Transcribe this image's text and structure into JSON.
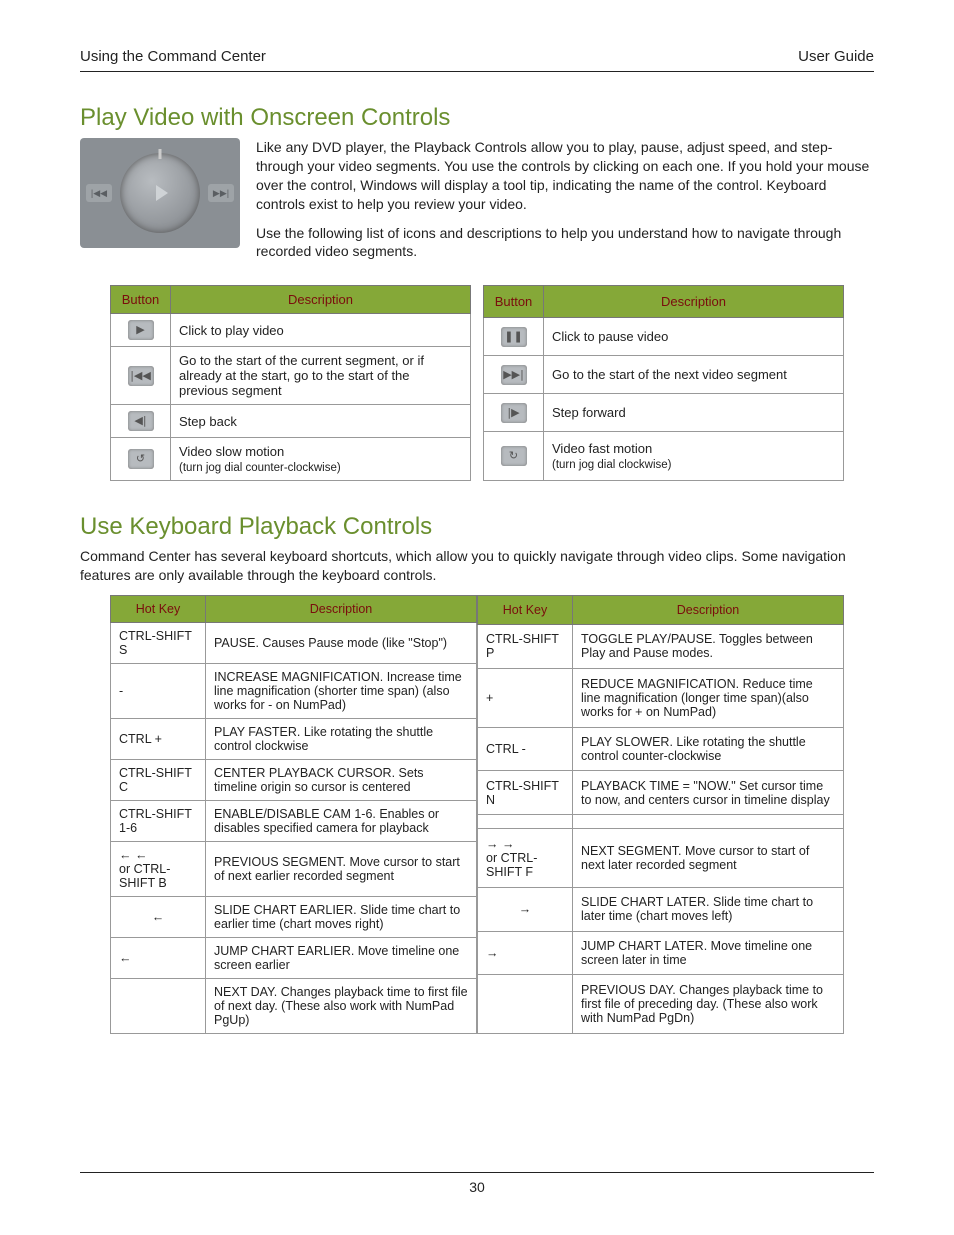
{
  "header": {
    "left": "Using the Command Center",
    "right": "User Guide"
  },
  "section1": {
    "title": "Play Video with Onscreen Controls",
    "intro1": "Like any DVD player, the Playback Controls allow you to play, pause, adjust speed, and step-through your video segments. You use the controls by clicking on each one. If you hold your mouse over the control, Windows will display a tool tip, indicating the name of the control. Keyboard controls exist to help you review your video.",
    "intro2": "Use the following list of icons and descriptions to help you understand how to navigate through recorded video segments.",
    "table_headers": {
      "button": "Button",
      "description": "Description"
    },
    "left_rows": [
      {
        "icon": "▶",
        "desc": "Click to play video"
      },
      {
        "icon": "|◀◀",
        "desc": "Go to the start of the current segment, or if already at the start, go to the start of the previous segment"
      },
      {
        "icon": "◀|",
        "desc": "Step back"
      },
      {
        "icon": "↺",
        "desc": "Video slow motion",
        "sub": "(turn jog dial counter-clockwise)"
      }
    ],
    "right_rows": [
      {
        "icon": "❚❚",
        "desc": "Click to pause video"
      },
      {
        "icon": "▶▶|",
        "desc": "Go to the start of the next video segment"
      },
      {
        "icon": "|▶",
        "desc": "Step forward"
      },
      {
        "icon": "↻",
        "desc": "Video fast motion",
        "sub": "(turn jog dial clockwise)"
      }
    ]
  },
  "section2": {
    "title": "Use Keyboard Playback Controls",
    "intro": "Command Center has several keyboard shortcuts, which allow you to quickly navigate through video clips. Some navigation features are only available through the keyboard controls.",
    "table_headers": {
      "hotkey": "Hot Key",
      "description": "Description"
    },
    "left_rows": [
      {
        "key": "CTRL-SHIFT S",
        "desc": "PAUSE. Causes Pause mode (like \"Stop\")"
      },
      {
        "key": "-",
        "desc": "INCREASE MAGNIFICATION.  Increase time line magnification (shorter time span) (also works for - on NumPad)"
      },
      {
        "key": "CTRL +",
        "desc": "PLAY FASTER. Like rotating the shuttle control clockwise"
      },
      {
        "key": "CTRL-SHIFT C",
        "desc": "CENTER PLAYBACK CURSOR. Sets timeline origin so cursor is centered"
      },
      {
        "key": "CTRL-SHIFT 1-6",
        "desc": "ENABLE/DISABLE CAM 1-6. Enables or disables specified camera for playback"
      },
      {
        "key": "←  ←\nor CTRL-SHIFT B",
        "desc": "PREVIOUS SEGMENT. Move cursor to start of next earlier recorded segment"
      },
      {
        "key": "←",
        "desc": "SLIDE CHART EARLIER.  Slide time chart to earlier time (chart moves right)"
      },
      {
        "key": "←",
        "desc": "JUMP CHART EARLIER. Move timeline one screen earlier"
      },
      {
        "key": "",
        "desc": "NEXT DAY. Changes playback time to first file of next day. (These also work with NumPad PgUp)"
      }
    ],
    "right_rows": [
      {
        "key": "CTRL-SHIFT P",
        "desc": "TOGGLE PLAY/PAUSE.  Toggles between Play and Pause modes."
      },
      {
        "key": "+",
        "desc": "REDUCE MAGNIFICATION.  Reduce time line magnification (longer time span)(also works for + on NumPad)"
      },
      {
        "key": "CTRL -",
        "desc": "PLAY SLOWER.  Like rotating the shuttle control counter-clockwise"
      },
      {
        "key": "CTRL-SHIFT N",
        "desc": "PLAYBACK TIME = \"NOW.\" Set cursor time to now, and centers cursor in timeline display"
      },
      {
        "key": "",
        "desc": ""
      },
      {
        "key": "→  →\nor CTRL-SHIFT F",
        "desc": "NEXT SEGMENT. Move cursor to start of next later recorded segment"
      },
      {
        "key": "→",
        "desc": "SLIDE CHART LATER.  Slide time chart to later time (chart moves left)"
      },
      {
        "key": "→",
        "desc": "JUMP CHART LATER. Move timeline one screen later in time"
      },
      {
        "key": "",
        "desc": "PREVIOUS DAY. Changes playback time to first file of preceding day. (These also work with NumPad PgDn)"
      }
    ]
  },
  "footer": {
    "page_number": "30"
  }
}
